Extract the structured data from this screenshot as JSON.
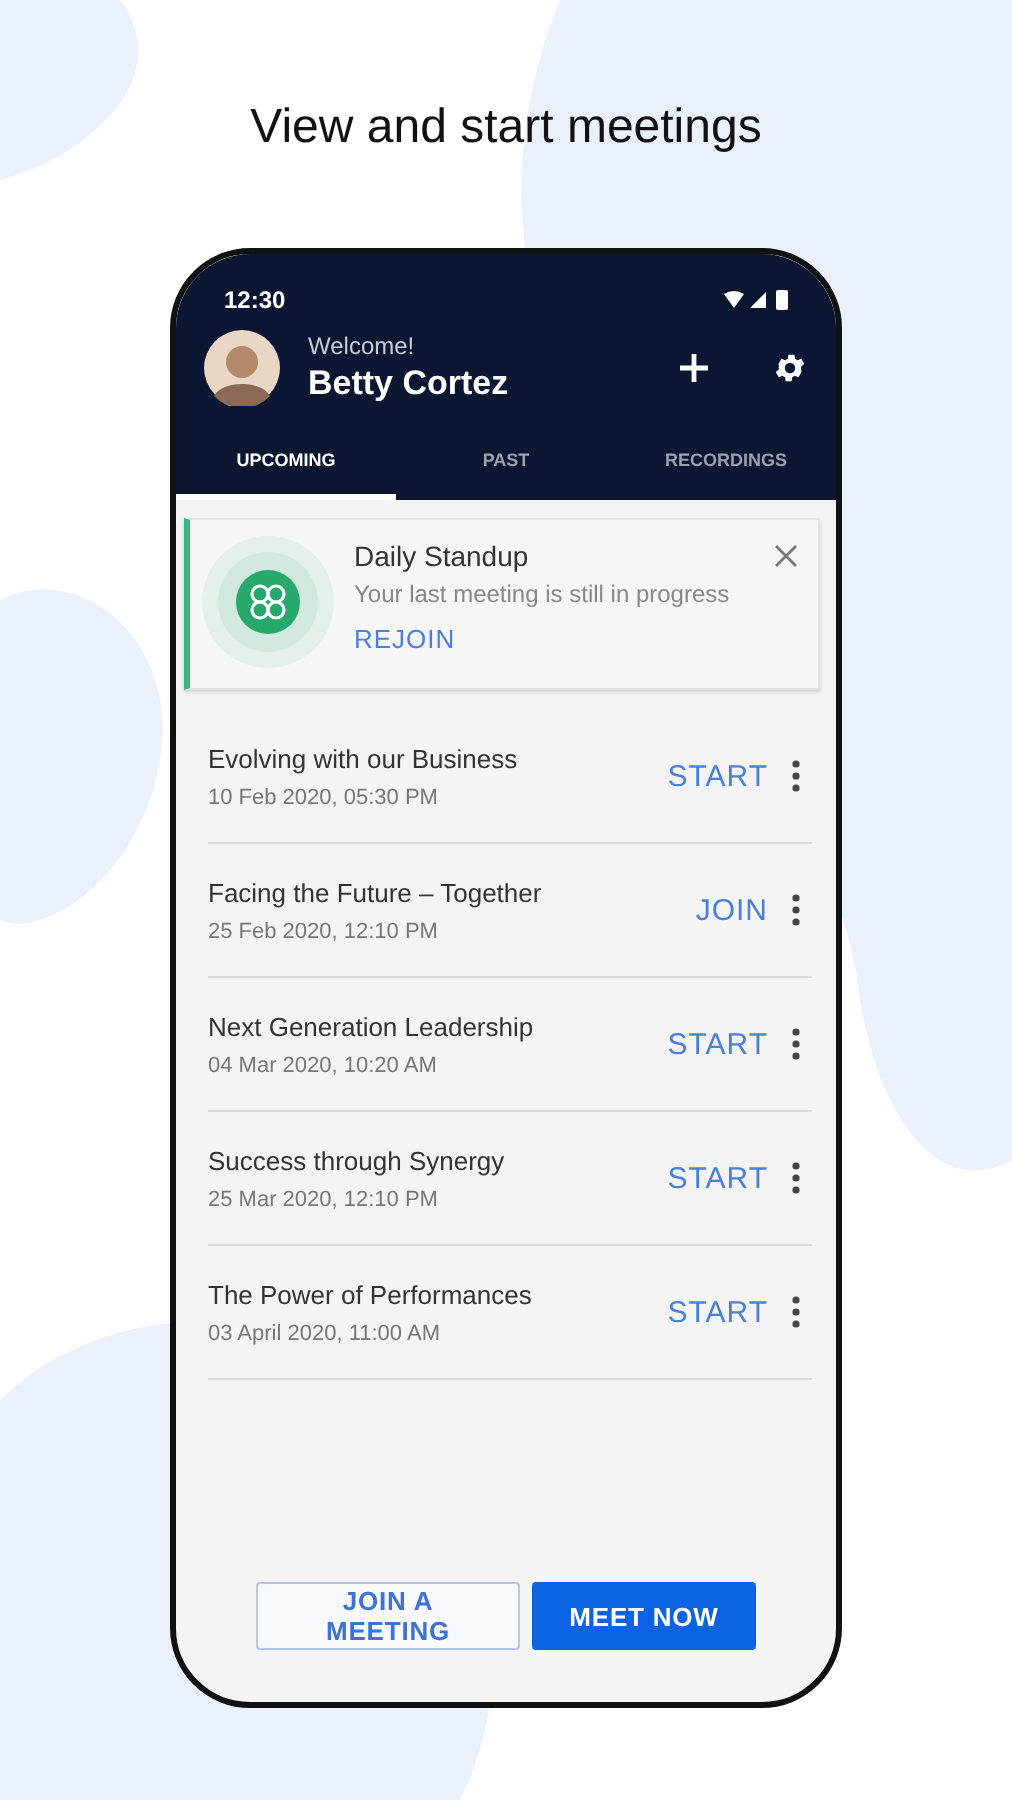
{
  "heading": "View and start meetings",
  "status_bar": {
    "time": "12:30"
  },
  "profile": {
    "greeting": "Welcome!",
    "name": "Betty Cortez"
  },
  "tabs": [
    {
      "label": "UPCOMING",
      "selected": true
    },
    {
      "label": "PAST",
      "selected": false
    },
    {
      "label": "RECORDINGS",
      "selected": false
    }
  ],
  "ongoing": {
    "title": "Daily Standup",
    "message": "Your last meeting is still in progress",
    "action": "REJOIN"
  },
  "meetings": [
    {
      "title": "Evolving with our Business",
      "time": "10 Feb 2020, 05:30 PM",
      "action": "START"
    },
    {
      "title": "Facing the Future – Together",
      "time": "25 Feb 2020, 12:10 PM",
      "action": "JOIN"
    },
    {
      "title": "Next Generation Leadership",
      "time": "04 Mar 2020, 10:20 AM",
      "action": "START"
    },
    {
      "title": "Success through Synergy",
      "time": "25 Mar 2020, 12:10 PM",
      "action": "START"
    },
    {
      "title": "The Power of Performances",
      "time": "03 April 2020, 11:00 AM",
      "action": "START"
    }
  ],
  "buttons": [
    {
      "label": "JOIN A MEETING",
      "kind": "outline"
    },
    {
      "label": "MEET NOW",
      "kind": "primary"
    }
  ]
}
